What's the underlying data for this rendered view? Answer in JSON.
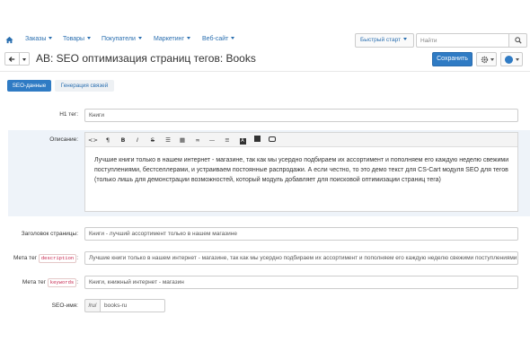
{
  "nav": {
    "items": [
      {
        "label": "Заказы"
      },
      {
        "label": "Товары"
      },
      {
        "label": "Покупатели"
      },
      {
        "label": "Маркетинг"
      },
      {
        "label": "Веб-сайт"
      }
    ],
    "quick_start_label": "Быстрый старт",
    "search_placeholder": "Найти"
  },
  "header": {
    "title": "AB: SEO оптимизация страниц тегов: Books",
    "save_label": "Сохранить"
  },
  "tabs": [
    {
      "label": "SEO-данные",
      "active": true
    },
    {
      "label": "Генерация связей",
      "active": false
    }
  ],
  "form": {
    "h1_label": "H1 тег:",
    "h1_value": "Книги",
    "description_label": "Описание:",
    "description_text": "Лучшие книги только в нашем интернет - магазине, так как мы усердно подбираем их ассортимент и пополняем его каждую неделю свежими поступлениями, бестселлерами, и устраиваем постоянные распродажи. А если честно, то это демо текст для CS-Cart модуля SEO для тегов (только лишь для демонстрации возможностей, который модуль добавляет для поисковой оптимизации страниц тега)",
    "page_title_label": "Заголовок страницы:",
    "page_title_value": "Книги - лучший ассортимент только в нашем магазине",
    "meta_desc_label_prefix": "Мета тег",
    "meta_desc_tag": "description",
    "meta_desc_suffix": ":",
    "meta_desc_value": "Лучшие книги только в нашем интернет - магазине, так как мы усердно подбираем их ассортимент и пополняем его каждую неделю свежими поступлениями",
    "meta_kw_label_prefix": "Мета тег",
    "meta_kw_tag": "keywords",
    "meta_kw_suffix": ":",
    "meta_kw_value": "Книги, книжный интернет - магазин",
    "seo_name_label": "SEO-имя:",
    "seo_name_prefix": "/ru/",
    "seo_name_value": "books-ru"
  },
  "colors": {
    "accent": "#2f7bc4",
    "link": "#2a6fb0",
    "panel": "#eef3f9"
  }
}
